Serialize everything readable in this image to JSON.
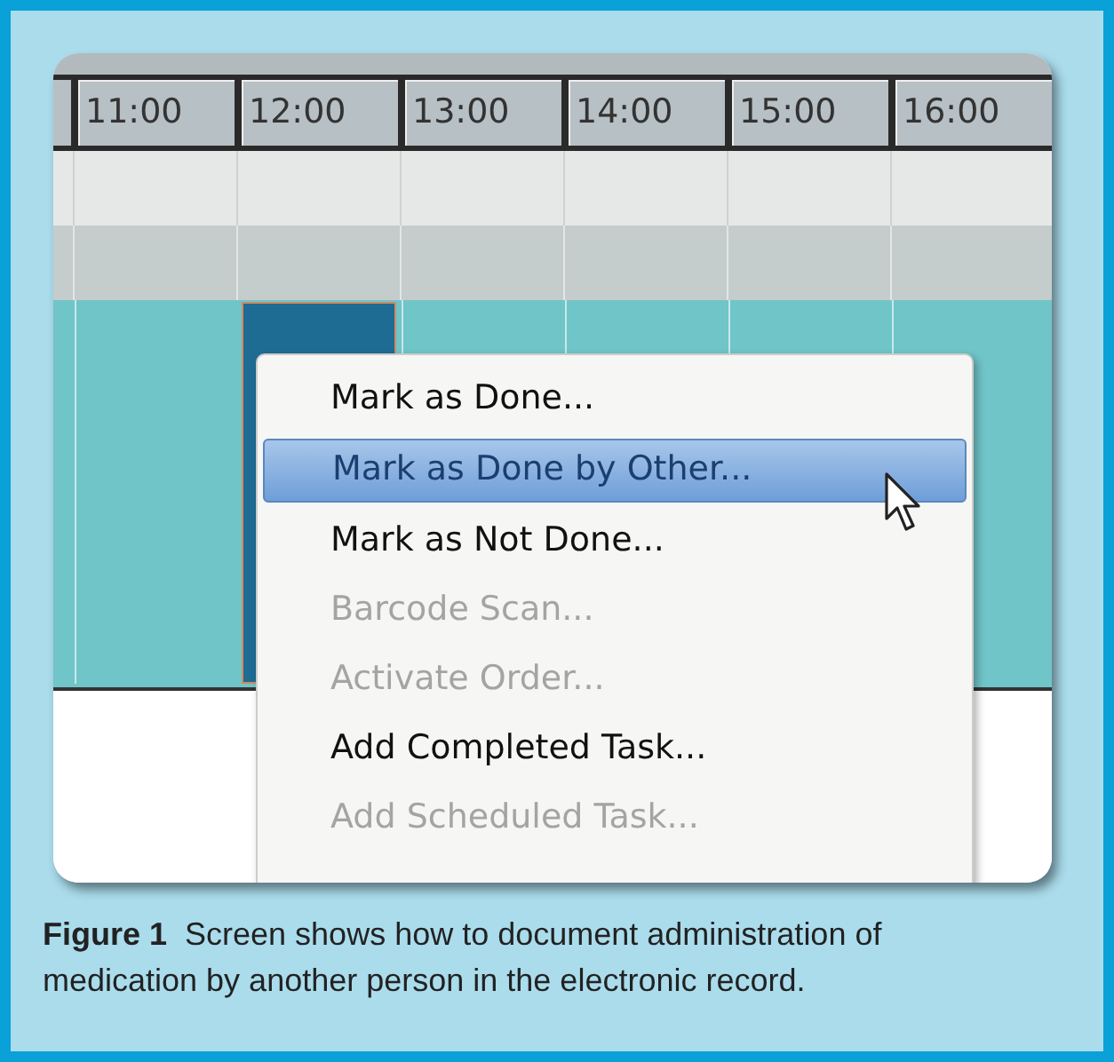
{
  "schedule": {
    "hours": [
      {
        "label": "11:00",
        "selected": false
      },
      {
        "label": "12:00",
        "selected": true
      },
      {
        "label": "13:00",
        "selected": false
      },
      {
        "label": "14:00",
        "selected": false
      },
      {
        "label": "15:00",
        "selected": false
      },
      {
        "label": "16:00",
        "selected": false
      }
    ]
  },
  "context_menu": {
    "items": [
      {
        "label": "Mark as Done...",
        "disabled": false,
        "selected": false
      },
      {
        "label": "Mark as Done by Other...",
        "disabled": false,
        "selected": true
      },
      {
        "label": "Mark as Not Done...",
        "disabled": false,
        "selected": false
      },
      {
        "label": "Barcode Scan...",
        "disabled": true,
        "selected": false
      },
      {
        "label": "Activate Order...",
        "disabled": true,
        "selected": false
      },
      {
        "label": "Add Completed Task...",
        "disabled": false,
        "selected": false
      },
      {
        "label": "Add Scheduled Task...",
        "disabled": true,
        "selected": false
      }
    ]
  },
  "caption": {
    "label": "Figure 1",
    "text": "Screen shows how to document administration of medication by another person in the electronic record."
  }
}
